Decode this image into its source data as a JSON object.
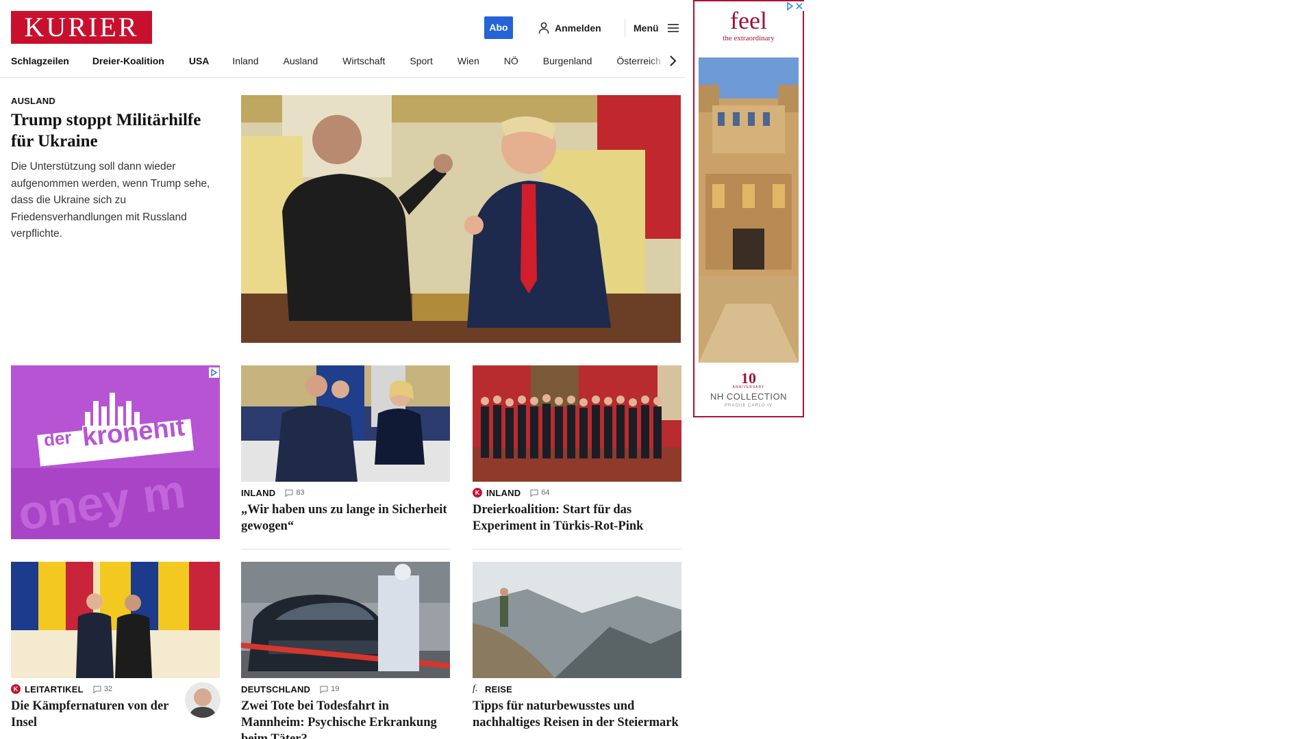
{
  "header": {
    "logo": "KURIER",
    "abo_label": "Abo",
    "login_label": "Anmelden",
    "menu_label": "Menü"
  },
  "nav": {
    "items": [
      "Schlagzeilen",
      "Dreier-Koalition",
      "USA",
      "Inland",
      "Ausland",
      "Wirtschaft",
      "Sport",
      "Wien",
      "NÖ",
      "Burgenland",
      "Österreich"
    ]
  },
  "lead": {
    "kicker": "AUSLAND",
    "title": "Trump stoppt Militärhilfe für Ukraine",
    "text": "Die Unterstützung soll dann wieder aufgenommen werden, wenn Trump sehe, dass die Ukraine sich zu Friedensverhandlungen mit Russland verpflichte."
  },
  "ads": {
    "left_brand_prefix": "der",
    "left_brand_main": "kronehit",
    "left_bg_text": "oney m",
    "right_headline": "feel",
    "right_sub": "the extraordinary",
    "right_badge": "10",
    "right_anniversary": "ANNIVERSARY",
    "right_collection": "NH COLLECTION",
    "right_location": "PRAGUE CARLO IV"
  },
  "cards": [
    {
      "kicker": "INLAND",
      "comments": "83",
      "title": "„Wir haben uns zu lange in Sicherheit gewogen“"
    },
    {
      "kicker": "INLAND",
      "comments": "64",
      "title": "Dreierkoalition: Start für das Experiment in Türkis-Rot-Pink"
    },
    {
      "kicker": "LEITARTIKEL",
      "comments": "32",
      "title": "Die Kämpfernaturen von der Insel"
    },
    {
      "kicker": "DEUTSCHLAND",
      "comments": "19",
      "title": "Zwei Tote bei Todesfahrt in Mannheim: Psychische Erkrankung beim Täter?"
    },
    {
      "kicker": "REISE",
      "title": "Tipps für naturbewusstes und nachhaltiges Reisen in der Steiermark"
    }
  ],
  "colors": {
    "brand": "#c8102e",
    "abo": "#2563d6",
    "ad_left_bg": "#b754d3",
    "ad_right_accent": "#9b1236"
  }
}
